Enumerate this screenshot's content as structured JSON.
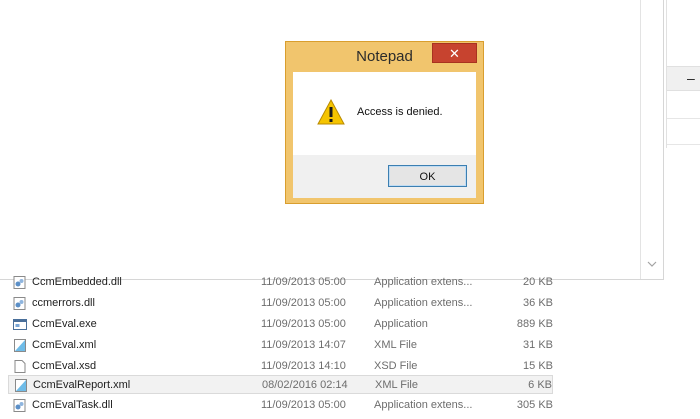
{
  "dialog": {
    "title": "Notepad",
    "close_glyph": "✕",
    "message": "Access is denied.",
    "icon": "warning-icon",
    "ok_label": "OK"
  },
  "side_pane": {
    "collapse_glyph": "–"
  },
  "files": [
    {
      "name": "CcmEmbedded.dll",
      "date": "11/09/2013 05:00",
      "type": "Application extens...",
      "size": "20 KB",
      "icon": "dll-icon"
    },
    {
      "name": "ccmerrors.dll",
      "date": "11/09/2013 05:00",
      "type": "Application extens...",
      "size": "36 KB",
      "icon": "dll-icon"
    },
    {
      "name": "CcmEval.exe",
      "date": "11/09/2013 05:00",
      "type": "Application",
      "size": "889 KB",
      "icon": "exe-icon"
    },
    {
      "name": "CcmEval.xml",
      "date": "11/09/2013 14:07",
      "type": "XML File",
      "size": "31 KB",
      "icon": "xml-icon"
    },
    {
      "name": "CcmEval.xsd",
      "date": "11/09/2013 14:10",
      "type": "XSD File",
      "size": "15 KB",
      "icon": "blank-file-icon"
    },
    {
      "name": "CcmEvalReport.xml",
      "date": "08/02/2016 02:14",
      "type": "XML File",
      "size": "6 KB",
      "icon": "xml-icon",
      "selected": true
    },
    {
      "name": "CcmEvalTask.dll",
      "date": "11/09/2013 05:00",
      "type": "Application extens...",
      "size": "305 KB",
      "icon": "dll-icon"
    }
  ]
}
